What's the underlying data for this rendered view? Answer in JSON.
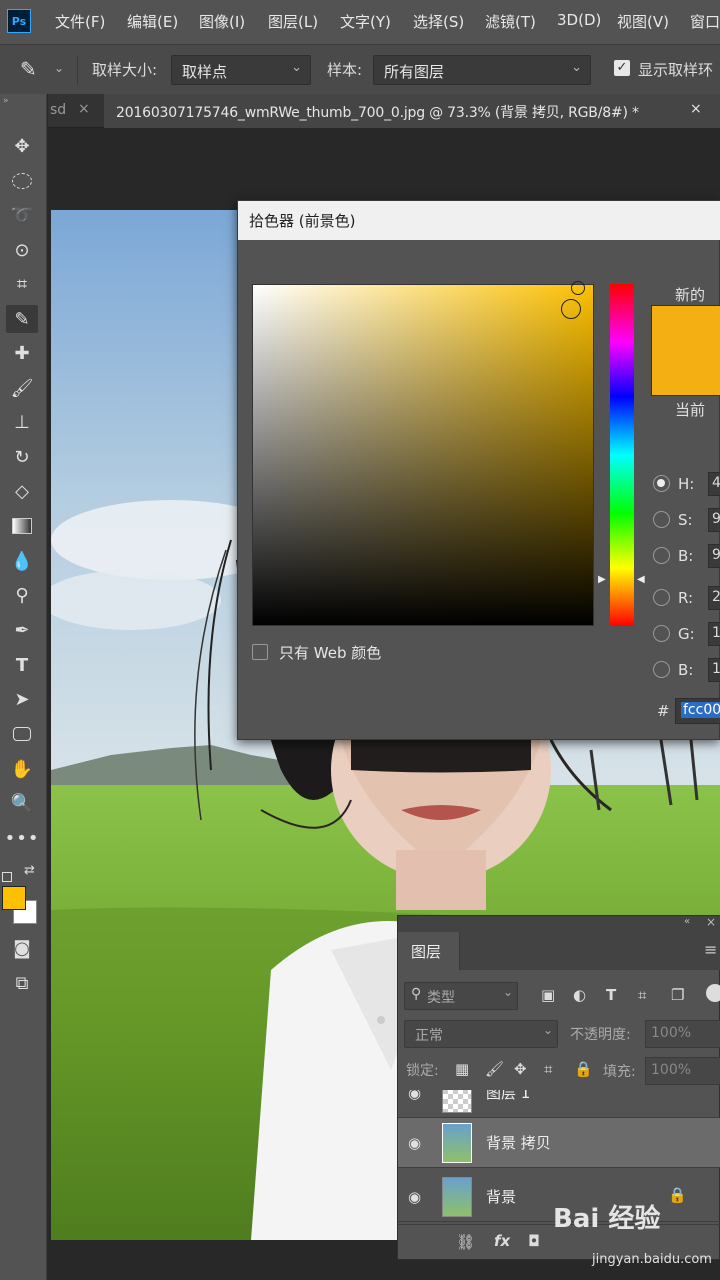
{
  "app": {
    "logo": "Ps"
  },
  "menubar": {
    "items": [
      "文件(F)",
      "编辑(E)",
      "图像(I)",
      "图层(L)",
      "文字(Y)",
      "选择(S)",
      "滤镜(T)",
      "3D(D)",
      "视图(V)",
      "窗口"
    ]
  },
  "options": {
    "sample_size_label": "取样大小:",
    "sample_size_value": "取样点",
    "sample_label": "样本:",
    "sample_value": "所有图层",
    "show_ring_label": "显示取样环"
  },
  "tabs": [
    {
      "label": "sd",
      "close": "×"
    },
    {
      "label": "20160307175746_wmRWe_thumb_700_0.jpg @ 73.3% (背景 拷贝, RGB/8#) *",
      "close": "×"
    }
  ],
  "tools": [
    "move-tool",
    "marquee-tool",
    "lasso-tool",
    "quick-select-tool",
    "crop-tool",
    "eyedropper-tool",
    "healing-tool",
    "brush-tool",
    "stamp-tool",
    "history-brush-tool",
    "eraser-tool",
    "gradient-tool",
    "blur-tool",
    "dodge-tool",
    "pen-tool",
    "type-tool",
    "path-select-tool",
    "shape-tool",
    "hand-tool",
    "zoom-tool",
    "more-tool"
  ],
  "colors": {
    "foreground": "#fcc000",
    "background": "#ffffff",
    "picked": "#f4b012"
  },
  "dialog": {
    "title": "拾色器 (前景色)",
    "new_label": "新的",
    "current_label": "当前",
    "web_only_label": "只有 Web 颜色",
    "fields": [
      {
        "label": "H:",
        "value": "4",
        "selected": true
      },
      {
        "label": "S:",
        "value": "9",
        "selected": false
      },
      {
        "label": "B:",
        "value": "9",
        "selected": false
      },
      {
        "label": "R:",
        "value": "2",
        "selected": false
      },
      {
        "label": "G:",
        "value": "1",
        "selected": false
      },
      {
        "label": "B:",
        "value": "1",
        "selected": false
      }
    ],
    "hex_label": "#",
    "hex_value": "fcc00"
  },
  "layers_panel": {
    "title": "图层",
    "filter_placeholder": "类型",
    "blend_mode": "正常",
    "opacity_label": "不透明度:",
    "opacity_value": "100%",
    "lock_label": "锁定:",
    "fill_label": "填充:",
    "fill_value": "100%",
    "layers": [
      {
        "name": "图层 1",
        "partial": true
      },
      {
        "name": "背景 拷贝",
        "selected": true
      },
      {
        "name": "背景",
        "locked": true
      }
    ],
    "footer": [
      "link-icon",
      "fx-icon",
      "mask-icon"
    ]
  },
  "watermark": {
    "main": "Bai 经验",
    "sub": "jingyan.baidu.com"
  }
}
